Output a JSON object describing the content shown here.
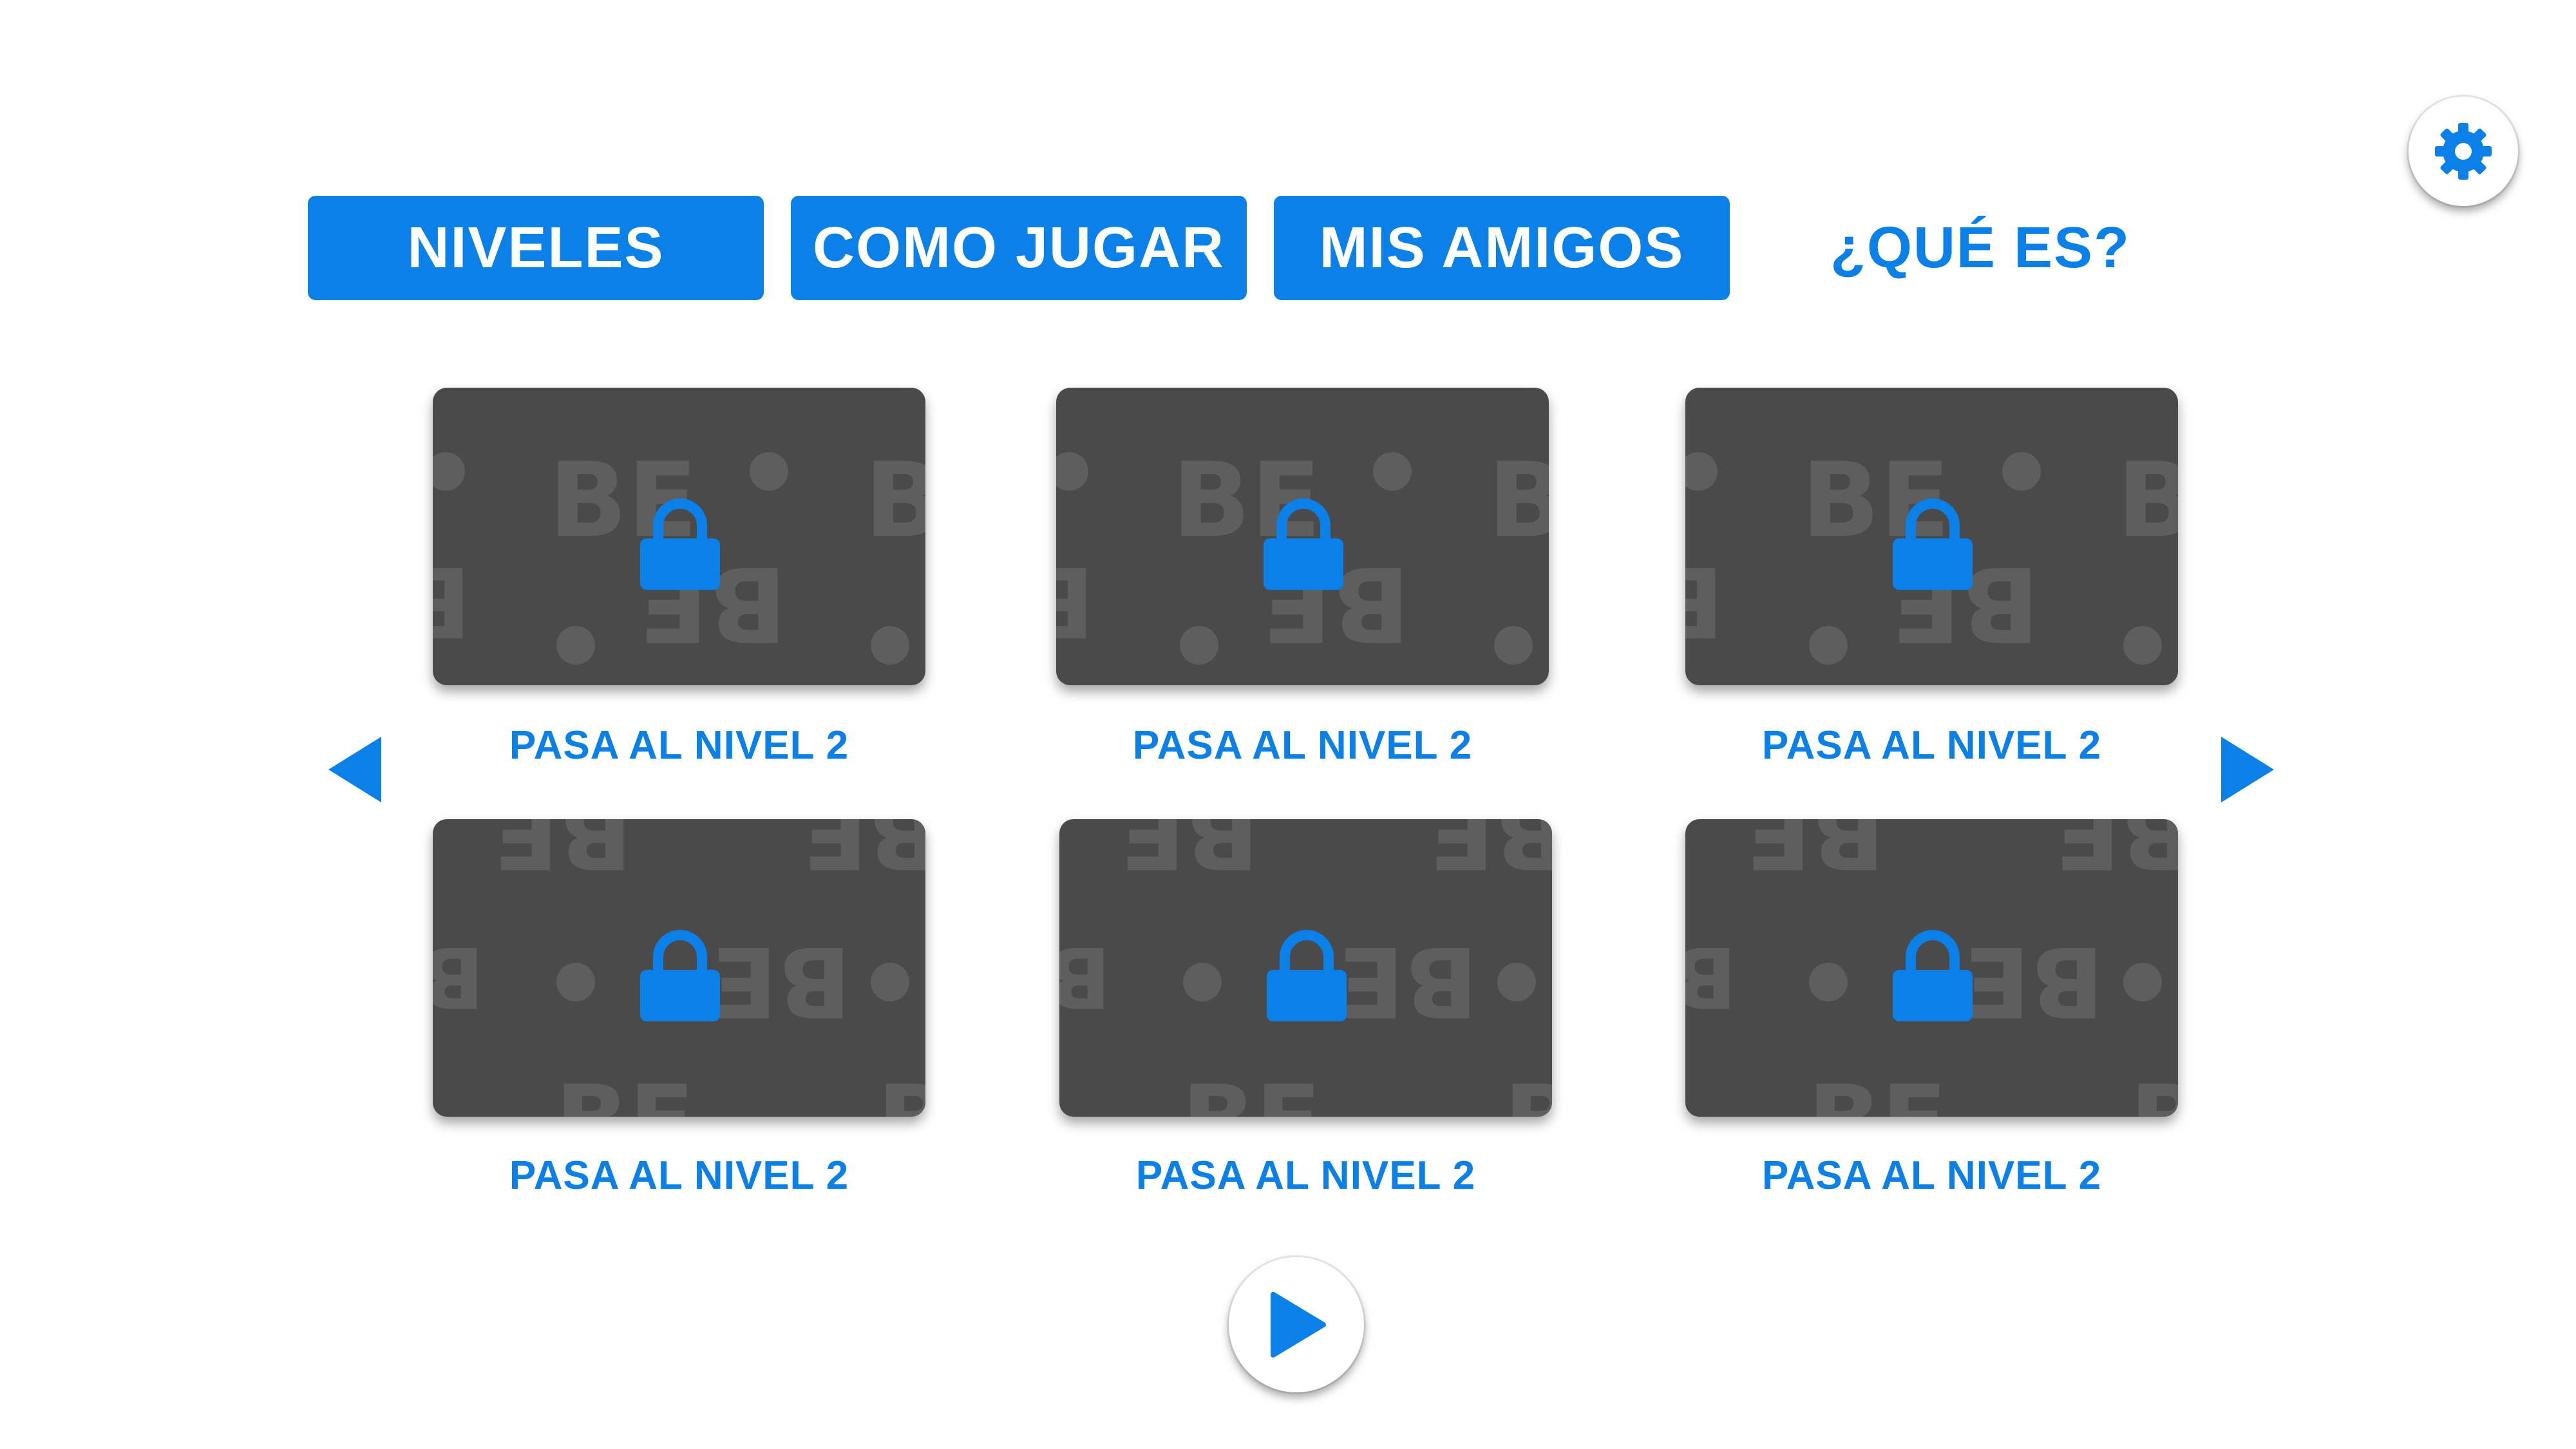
{
  "header": {
    "tabs": [
      {
        "label": "NIVELES",
        "style": "filled"
      },
      {
        "label": "COMO JUGAR",
        "style": "filled"
      },
      {
        "label": "MIS AMIGOS",
        "style": "filled"
      },
      {
        "label": "¿QUÉ ES?",
        "style": "plain"
      }
    ],
    "settings_icon": "gear-icon"
  },
  "levels": {
    "cards": [
      {
        "label": "PASA AL NIVEL 2",
        "locked": true,
        "icon": "lock-icon"
      },
      {
        "label": "PASA AL NIVEL 2",
        "locked": true,
        "icon": "lock-icon"
      },
      {
        "label": "PASA AL NIVEL 2",
        "locked": true,
        "icon": "lock-icon"
      },
      {
        "label": "PASA AL NIVEL 2",
        "locked": true,
        "icon": "lock-icon"
      },
      {
        "label": "PASA AL NIVEL 2",
        "locked": true,
        "icon": "lock-icon"
      },
      {
        "label": "PASA AL NIVEL 2",
        "locked": true,
        "icon": "lock-icon"
      }
    ],
    "pattern_text": "BE",
    "prev_icon": "arrow-left-icon",
    "next_icon": "arrow-right-icon"
  },
  "footer": {
    "play_icon": "play-icon"
  },
  "colors": {
    "accent": "#0a80e8",
    "card_bg": "#4a4a4a",
    "pattern": "#5e5e5e",
    "background": "#ffffff"
  }
}
